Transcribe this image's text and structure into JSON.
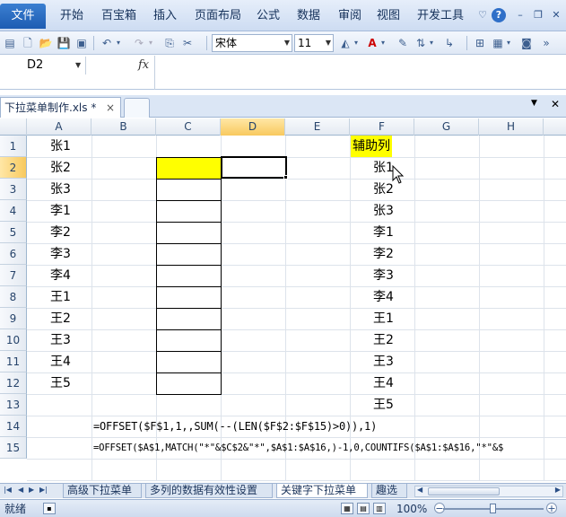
{
  "menu": {
    "file": "文件",
    "items": [
      "开始",
      "百宝箱",
      "插入",
      "页面布局",
      "公式",
      "数据",
      "审阅",
      "视图",
      "开发工具"
    ]
  },
  "toolbar": {
    "font_name": "宋体",
    "font_size": "11"
  },
  "formula_bar": {
    "cell_ref": "D2",
    "fx": "fx",
    "content": ""
  },
  "workbook_tab": {
    "title": "下拉菜单制作.xls *",
    "close": "×"
  },
  "grid": {
    "columns": [
      "A",
      "B",
      "C",
      "D",
      "E",
      "F",
      "G",
      "H"
    ],
    "rows": [
      "1",
      "2",
      "3",
      "4",
      "5",
      "6",
      "7",
      "8",
      "9",
      "10",
      "11",
      "12",
      "13",
      "14",
      "15"
    ],
    "col_a": [
      "张1",
      "张2",
      "张3",
      "李1",
      "李2",
      "李3",
      "李4",
      "王1",
      "王2",
      "王3",
      "王4",
      "王5"
    ],
    "col_f_header": "辅助列",
    "col_f": [
      "张1",
      "张2",
      "张3",
      "李1",
      "李2",
      "李3",
      "李4",
      "王1",
      "王2",
      "王3",
      "王4",
      "王5"
    ],
    "formula_row14": "=OFFSET($F$1,1,,SUM(--(LEN($F$2:$F$15)>0)),1)",
    "formula_row15": "=OFFSET($A$1,MATCH(\"*\"&$C$2&\"*\",$A$1:$A$16,)-1,0,COUNTIFS($A$1:$A$16,\"*\"&$",
    "highlight_color": "#ffff00"
  },
  "sheets": {
    "tabs": [
      "高级下拉菜单",
      "多列的数据有效性设置",
      "关键字下拉菜单",
      "趣选"
    ],
    "active": 2
  },
  "status": {
    "text": "就绪",
    "zoom": "100%"
  }
}
